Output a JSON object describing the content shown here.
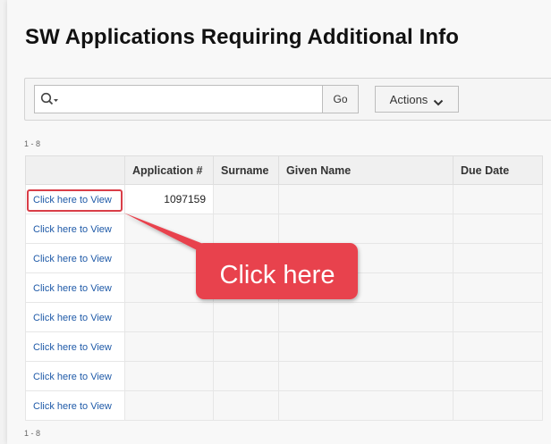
{
  "page_title": "SW Applications Requiring Additional Info",
  "toolbar": {
    "search_placeholder": "",
    "go_label": "Go",
    "actions_label": "Actions"
  },
  "pagination": {
    "top": "1 - 8",
    "bottom": "1 - 8"
  },
  "table": {
    "headers": [
      "",
      "Application #",
      "Surname",
      "Given Name",
      "Due Date"
    ],
    "rows": [
      {
        "link": "Click here to View",
        "application": "1097159",
        "surname": "",
        "given_name": "",
        "due_date": ""
      },
      {
        "link": "Click here to View",
        "application": "",
        "surname": "",
        "given_name": "",
        "due_date": ""
      },
      {
        "link": "Click here to View",
        "application": "",
        "surname": "",
        "given_name": "",
        "due_date": ""
      },
      {
        "link": "Click here to View",
        "application": "",
        "surname": "",
        "given_name": "",
        "due_date": ""
      },
      {
        "link": "Click here to View",
        "application": "",
        "surname": "",
        "given_name": "",
        "due_date": ""
      },
      {
        "link": "Click here to View",
        "application": "",
        "surname": "",
        "given_name": "",
        "due_date": ""
      },
      {
        "link": "Click here to View",
        "application": "",
        "surname": "",
        "given_name": "",
        "due_date": ""
      },
      {
        "link": "Click here to View",
        "application": "",
        "surname": "",
        "given_name": "",
        "due_date": ""
      }
    ]
  },
  "callout": {
    "text": "Click here",
    "color": "#e8434e"
  },
  "colors": {
    "link": "#1f5aa8",
    "highlight": "#d93e48"
  },
  "icons": {
    "search": "search-icon",
    "actions": "chevron-down-icon"
  }
}
